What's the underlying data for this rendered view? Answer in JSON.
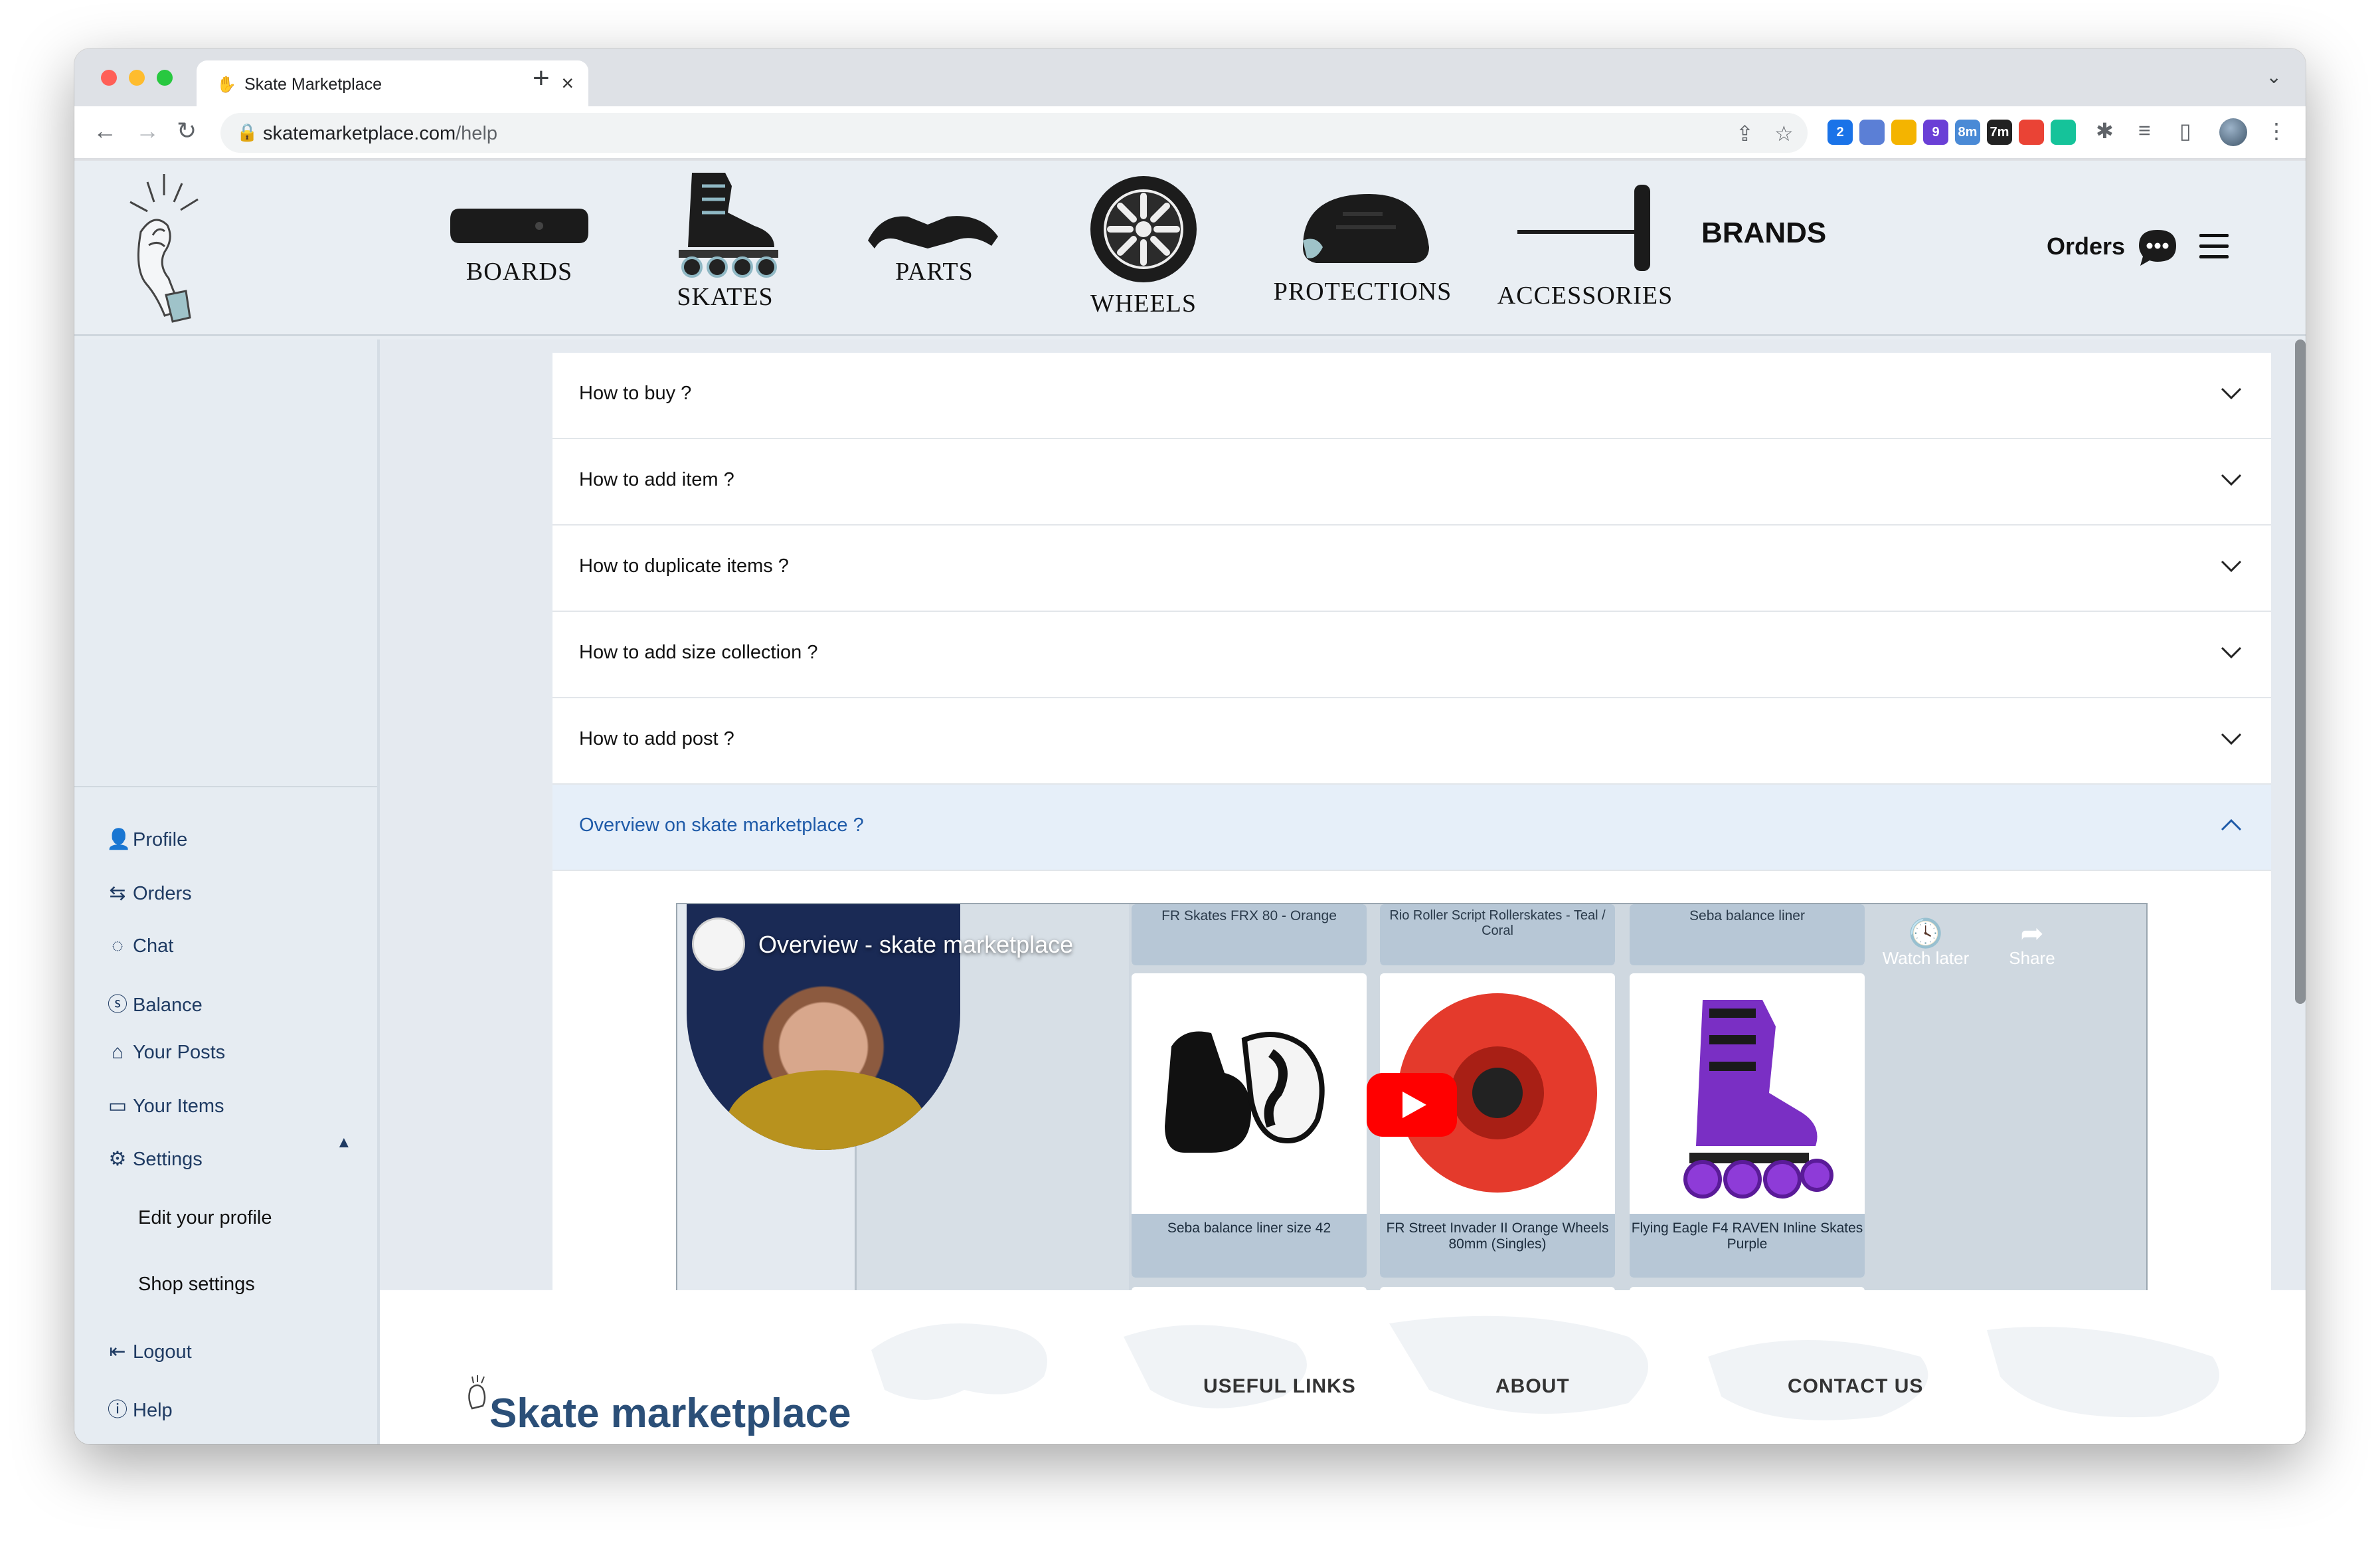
{
  "browser": {
    "tab_title": "Skate Marketplace",
    "url_host": "skatemarketplace.com",
    "url_path": "/help",
    "extensions": [
      {
        "name": "translate",
        "badge": "2",
        "color": "#1a73e8"
      },
      {
        "name": "docs-icon",
        "badge": "",
        "color": "#5b7fd6"
      },
      {
        "name": "analytics-icon",
        "badge": "",
        "color": "#f4b400"
      },
      {
        "name": "cube-icon",
        "badge": "9",
        "color": "#6a3fd6"
      },
      {
        "name": "tasks-icon",
        "badge": "8m",
        "color": "#4a8ad6"
      },
      {
        "name": "timer-icon",
        "badge": "7m",
        "color": "#222222"
      },
      {
        "name": "gmail-icon",
        "badge": "",
        "color": "#ea4335"
      },
      {
        "name": "grammarly-icon",
        "badge": "",
        "color": "#15c39a"
      }
    ]
  },
  "header": {
    "categories": [
      {
        "label": "BOARDS",
        "icon": "board-icon"
      },
      {
        "label": "SKATES",
        "icon": "skate-icon"
      },
      {
        "label": "PARTS",
        "icon": "parts-icon"
      },
      {
        "label": "WHEELS",
        "icon": "wheel-icon"
      },
      {
        "label": "PROTECTIONS",
        "icon": "helmet-icon"
      },
      {
        "label": "ACCESSORIES",
        "icon": "tool-icon"
      }
    ],
    "brands": "BRANDS",
    "orders": "Orders"
  },
  "sidebar": {
    "items": [
      {
        "label": "Profile",
        "icon": "user-icon"
      },
      {
        "label": "Orders",
        "icon": "swap-icon"
      },
      {
        "label": "Chat",
        "icon": "chat-icon"
      },
      {
        "label": "Balance",
        "icon": "dollar-icon"
      },
      {
        "label": "Your Posts",
        "icon": "store-icon"
      },
      {
        "label": "Your Items",
        "icon": "box-icon"
      },
      {
        "label": "Settings",
        "icon": "gear-icon"
      }
    ],
    "settings_sub": [
      "Edit your profile",
      "Shop settings"
    ],
    "logout": "Logout",
    "help": "Help"
  },
  "faq": [
    {
      "q": "How to buy ?",
      "open": false
    },
    {
      "q": "How to add item ?",
      "open": false
    },
    {
      "q": "How to duplicate items ?",
      "open": false
    },
    {
      "q": "How to add size collection ?",
      "open": false
    },
    {
      "q": "How to add post ?",
      "open": false
    },
    {
      "q": "Overview on skate marketplace ?",
      "open": true
    }
  ],
  "video": {
    "title": "Overview - skate marketplace",
    "watch_later": "Watch later",
    "share": "Share",
    "top_products": [
      "FR Skates FRX 80 - Orange",
      "Rio Roller Script Rollerskates - Teal / Coral",
      "Seba balance liner"
    ],
    "products": [
      {
        "name": "Seba balance liner size 42"
      },
      {
        "name": "FR Street Invader II Orange Wheels 80mm (Singles)"
      },
      {
        "name": "Flying Eagle F4 RAVEN Inline Skates Purple"
      }
    ]
  },
  "footer": {
    "brand": "Skate marketplace",
    "useful_links": "USEFUL LINKS",
    "about": "ABOUT",
    "contact": "CONTACT US"
  }
}
